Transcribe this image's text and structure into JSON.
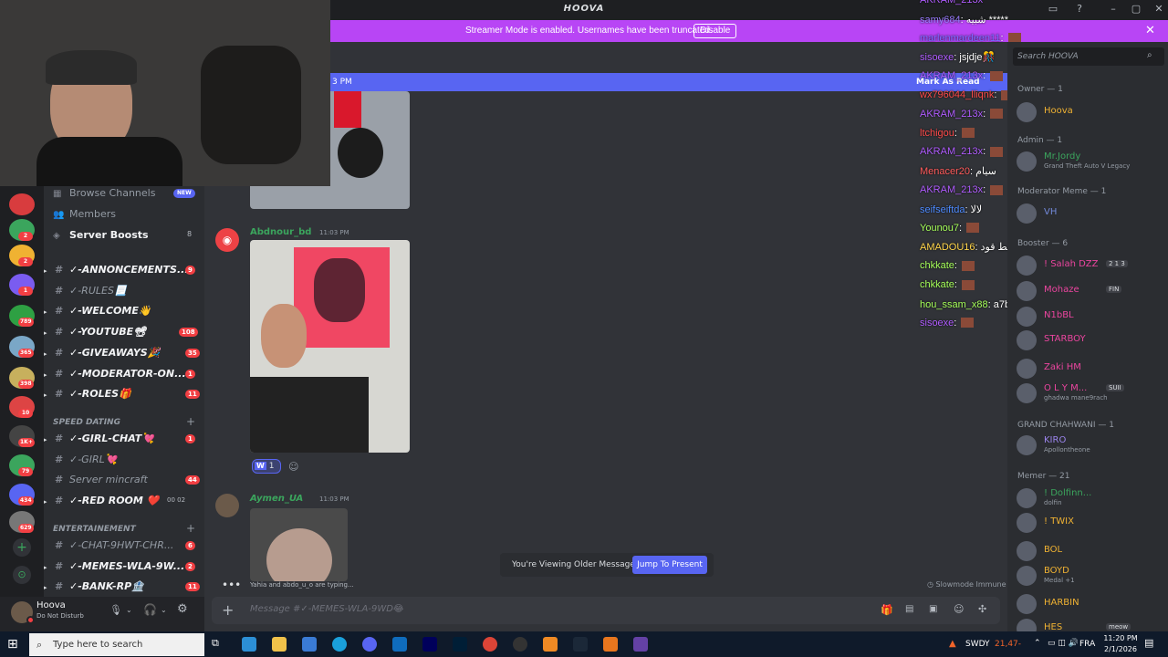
{
  "app": {
    "title": "HOOVA"
  },
  "banner": {
    "text": "Streamer Mode is enabled. Usernames have been truncated.",
    "disable_label": "Disable"
  },
  "newbar": {
    "time_fragment": "3 PM",
    "mark_read": "Mark As Read"
  },
  "server_badges": [
    "2",
    "2",
    "1",
    "789",
    "365",
    "398",
    "10",
    "1K+",
    "79",
    "434",
    "629"
  ],
  "channels": {
    "top": [
      {
        "label": "Browse Channels",
        "badge": "NEW"
      },
      {
        "label": "Members"
      },
      {
        "label": "Server Boosts",
        "count": "8"
      }
    ],
    "list1": [
      {
        "label": "✓-ANNONCEMENTS...",
        "badge": "9",
        "bold": true
      },
      {
        "label": "✓-RULES📃"
      },
      {
        "label": "✓-WELCOME👋",
        "bold": true
      },
      {
        "label": "✓-YOUTUBE📽",
        "badge": "108",
        "bold": true
      },
      {
        "label": "✓-GIVEAWAYS🎉",
        "badge": "35",
        "bold": true
      },
      {
        "label": "✓-MODERATOR-ON...",
        "badge": "1",
        "bold": true
      },
      {
        "label": "✓-ROLES🎁",
        "badge": "11",
        "bold": true
      }
    ],
    "cat1": "SPEED DATING",
    "list2": [
      {
        "label": "✓-GIRL-CHAT💘",
        "badge": "1",
        "bold": true
      },
      {
        "label": "✓-GIRL💘"
      },
      {
        "label": "Server mincraft",
        "badge": "44"
      },
      {
        "label": "✓-RED ROOM ❤️",
        "extra": "00  02",
        "bold": true
      }
    ],
    "cat2": "ENTERTAINEMENT",
    "list3": [
      {
        "label": "✓-CHAT-9HWT-CHR...",
        "badge": "6"
      },
      {
        "label": "✓-MEMES-WLA-9W...",
        "badge": "2",
        "bold": true
      },
      {
        "label": "✓-BANK-RP🏦",
        "badge": "11",
        "bold": true
      }
    ]
  },
  "user": {
    "name": "Hoova",
    "status": "Do Not Disturb"
  },
  "messages": [
    {
      "author": "Abdnour_bd",
      "time": "11:03 PM",
      "reaction_count": "1"
    },
    {
      "author": "Aymen_UA",
      "time": "11:03 PM"
    }
  ],
  "typing": {
    "text": "Yahia and abdo_u_o are typing..."
  },
  "slowmode": "Slowmode Immune",
  "older": {
    "text": "You're Viewing Older Messages",
    "jump": "Jump To Present"
  },
  "composer": {
    "placeholder": "Message #✓-MEMES-WLA-9WD😂"
  },
  "twitch_chat": [
    {
      "user": "AKRAM_213x",
      "color": "#b05cff",
      "msg": ""
    },
    {
      "user": "samy684",
      "color": "#9a7bff",
      "msg": ": شبيه *****"
    },
    {
      "user": "marlenmardeen11",
      "color": "#7b68ff",
      "msg": ":"
    },
    {
      "user": "sisoexe",
      "color": "#b05cff",
      "msg": ": jsjdje🎊"
    },
    {
      "user": "AKRAM_213x",
      "color": "#b05cff",
      "msg": ":"
    },
    {
      "user": "wx796044_lliqnk",
      "color": "#ff4a4a",
      "msg": ":"
    },
    {
      "user": "AKRAM_213x",
      "color": "#b05cff",
      "msg": ":"
    },
    {
      "user": "ltchigou",
      "color": "#ff4a4a",
      "msg": ":"
    },
    {
      "user": "AKRAM_213x",
      "color": "#b05cff",
      "msg": ":"
    },
    {
      "user": "Menacer20",
      "color": "#ff5b5b",
      "msg": ": سيام"
    },
    {
      "user": "AKRAM_213x",
      "color": "#b05cff",
      "msg": ":"
    },
    {
      "user": "seifseiftda",
      "color": "#4e8bff",
      "msg": ": لالا"
    },
    {
      "user": "Younou7",
      "color": "#a6ff5a",
      "msg": ":"
    },
    {
      "user": "AMADOU16",
      "color": "#ffd54a",
      "msg": ": قبلط قود"
    },
    {
      "user": "chkkate",
      "color": "#a6ff5a",
      "msg": ":"
    },
    {
      "user": "chkkate",
      "color": "#a6ff5a",
      "msg": ":"
    },
    {
      "user": "hou_ssam_x88",
      "color": "#a6ff5a",
      "msg": ": a7bett qwd 😂😂"
    },
    {
      "user": "sisoexe",
      "color": "#b05cff",
      "msg": ":"
    }
  ],
  "members": {
    "search_placeholder": "Search HOOVA",
    "groups": [
      {
        "role": "Owner — 1",
        "items": [
          {
            "name": "Hoova",
            "color": "#f0b232"
          }
        ]
      },
      {
        "role": "Admin — 1",
        "items": [
          {
            "name": "Mr.Jordy",
            "color": "#3ba55d",
            "sub": "Grand Theft Auto V Legacy"
          }
        ]
      },
      {
        "role": "Moderator Meme — 1",
        "items": [
          {
            "name": "VH",
            "color": "#7289da"
          }
        ]
      },
      {
        "role": "Booster — 6",
        "items": [
          {
            "name": "! Salah DZZ",
            "color": "#eb459f",
            "tag": "2 1 3"
          },
          {
            "name": "Mohaze",
            "color": "#eb459f",
            "tag": "FIN"
          },
          {
            "name": "N1bBL",
            "color": "#eb459f"
          },
          {
            "name": "STARBOY",
            "color": "#eb459f"
          },
          {
            "name": "Zaki HM",
            "color": "#eb459f"
          },
          {
            "name": "O L Y M...",
            "color": "#eb459f",
            "tag": "SUII",
            "sub": "ghadwa mane9rach"
          }
        ]
      },
      {
        "role": "GRAND CHAHWANI — 1",
        "items": [
          {
            "name": "KIRO",
            "color": "#9b84ec",
            "sub": "Apollontheone"
          }
        ]
      },
      {
        "role": "Memer — 21",
        "items": [
          {
            "name": "! Dolfinn...",
            "color": "#3ba55d",
            "sub": "dolfin"
          },
          {
            "name": "! TWIX",
            "color": "#f0b232"
          },
          {
            "name": "BOL",
            "color": "#f0b232"
          },
          {
            "name": "BOYD",
            "color": "#f0b232",
            "sub": "Medal +1"
          },
          {
            "name": "HARBIN",
            "color": "#f0b232"
          },
          {
            "name": "HES",
            "color": "#f0b232",
            "tag": "meow"
          }
        ]
      }
    ]
  },
  "taskbar": {
    "search_placeholder": "Type here to search",
    "weather": "SWDY",
    "weather_val": "21,47-",
    "lang": "FRA",
    "time": "11:20 PM",
    "date": "2/1/2026"
  },
  "colors": {
    "accent": "#5865f2",
    "banner": "#b845f5",
    "dnd": "#f23f43"
  }
}
